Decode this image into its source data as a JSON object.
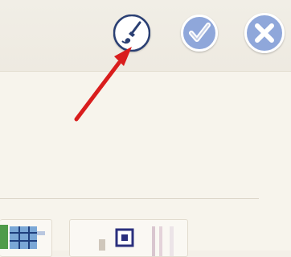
{
  "toolbar": {
    "buttons": [
      {
        "name": "brush-style-button",
        "icon": "paintbrush-icon"
      },
      {
        "name": "confirm-button",
        "icon": "checkmark-icon"
      },
      {
        "name": "close-button",
        "icon": "close-icon"
      }
    ]
  },
  "colors": {
    "button_fill": "#8fa7da",
    "button_ring": "#ffffff",
    "brush_button_fill": "#ffffff",
    "brush_icon": "#2a3f73",
    "annotation_arrow": "#d91d1d",
    "background": "#f4f0e8"
  },
  "annotation": {
    "type": "arrow",
    "points_to": "brush-style-button"
  },
  "thumbnails": [
    {
      "name": "thumbnail-1"
    },
    {
      "name": "thumbnail-2"
    }
  ]
}
